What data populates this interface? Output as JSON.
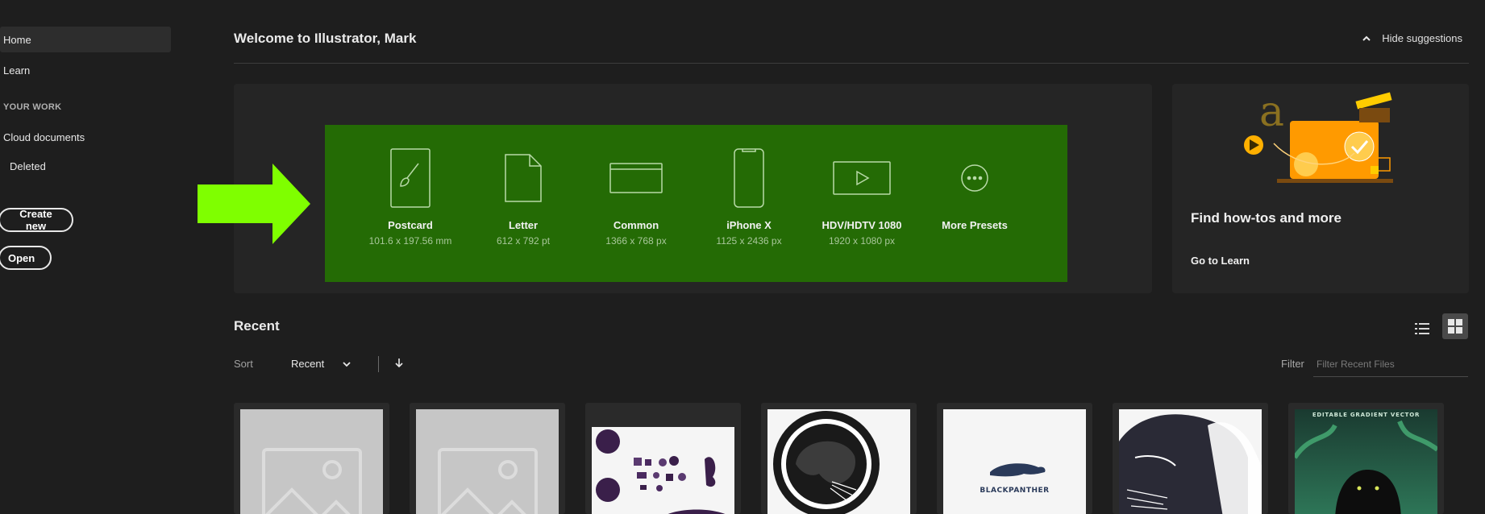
{
  "sidebar": {
    "nav": [
      {
        "label": "Home"
      },
      {
        "label": "Learn"
      }
    ],
    "section_label": "YOUR WORK",
    "cloud_documents": "Cloud documents",
    "deleted": "Deleted",
    "create_new": "Create new",
    "open": "Open"
  },
  "header": {
    "welcome": "Welcome to Illustrator, Mark",
    "hide_suggestions": "Hide suggestions"
  },
  "presets": [
    {
      "name": "Postcard",
      "size": "101.6 x 197.56 mm",
      "icon": "postcard-icon"
    },
    {
      "name": "Letter",
      "size": "612 x 792 pt",
      "icon": "letter-icon"
    },
    {
      "name": "Common",
      "size": "1366 x 768 px",
      "icon": "common-icon"
    },
    {
      "name": "iPhone X",
      "size": "1125 x 2436 px",
      "icon": "phone-icon"
    },
    {
      "name": "HDV/HDTV 1080",
      "size": "1920 x 1080 px",
      "icon": "video-icon"
    },
    {
      "name": "More Presets",
      "size": "",
      "icon": "more-icon"
    }
  ],
  "learn_card": {
    "title": "Find how-tos and more",
    "link": "Go to Learn"
  },
  "recent": {
    "title": "Recent",
    "sort_label": "Sort",
    "sort_value": "Recent",
    "filter_label": "Filter",
    "filter_placeholder": "Filter Recent Files",
    "logo_text": "BLACKPANTHER",
    "banner_text": "EDITABLE GRADIENT VECTOR"
  },
  "colors": {
    "highlight_green": "#246b05",
    "arrow_green": "#7fff00",
    "background": "#1e1e1e",
    "panel": "#252525"
  }
}
